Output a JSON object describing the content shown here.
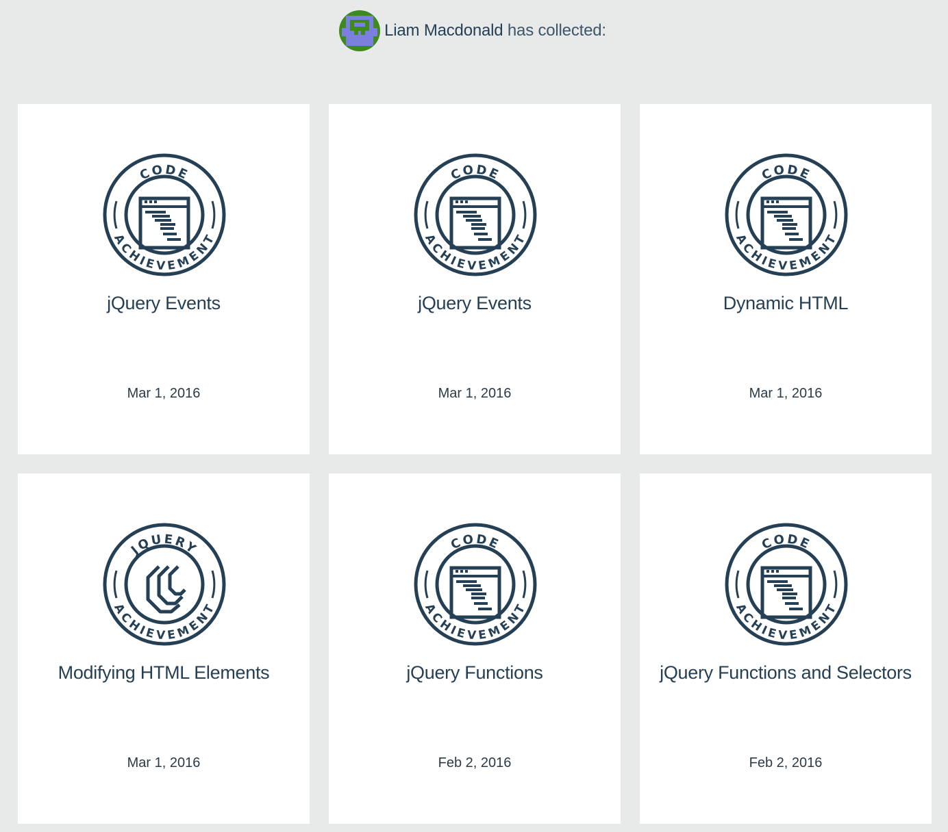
{
  "profile": {
    "avatar_icon": "pixel-invader-avatar-icon",
    "user_name": "Liam Macdonald",
    "collected_suffix": " has collected:"
  },
  "colors": {
    "ink": "#253f54",
    "background": "#e8eaea",
    "card": "#ffffff",
    "avatar_bg": "#3e8a1e",
    "avatar_figure": "#7b7fe0"
  },
  "achievements": [
    {
      "badge_type": "code",
      "badge_icon": "code-window-icon",
      "badge_top": "CODE",
      "badge_bottom": "ACHIEVEMENT",
      "title": "jQuery Events",
      "date": "Mar 1, 2016"
    },
    {
      "badge_type": "code",
      "badge_icon": "code-window-icon",
      "badge_top": "CODE",
      "badge_bottom": "ACHIEVEMENT",
      "title": "jQuery Events",
      "date": "Mar 1, 2016"
    },
    {
      "badge_type": "code",
      "badge_icon": "code-window-icon",
      "badge_top": "CODE",
      "badge_bottom": "ACHIEVEMENT",
      "title": "Dynamic HTML",
      "date": "Mar 1, 2016"
    },
    {
      "badge_type": "jquery",
      "badge_icon": "jquery-logo-icon",
      "badge_top": "JQUERY",
      "badge_bottom": "ACHIEVEMENT",
      "title": "Modifying HTML Elements",
      "date": "Mar 1, 2016"
    },
    {
      "badge_type": "code",
      "badge_icon": "code-window-icon",
      "badge_top": "CODE",
      "badge_bottom": "ACHIEVEMENT",
      "title": "jQuery Functions",
      "date": "Feb 2, 2016"
    },
    {
      "badge_type": "code",
      "badge_icon": "code-window-icon",
      "badge_top": "CODE",
      "badge_bottom": "ACHIEVEMENT",
      "title": "jQuery Functions and Selectors",
      "date": "Feb 2, 2016"
    }
  ]
}
